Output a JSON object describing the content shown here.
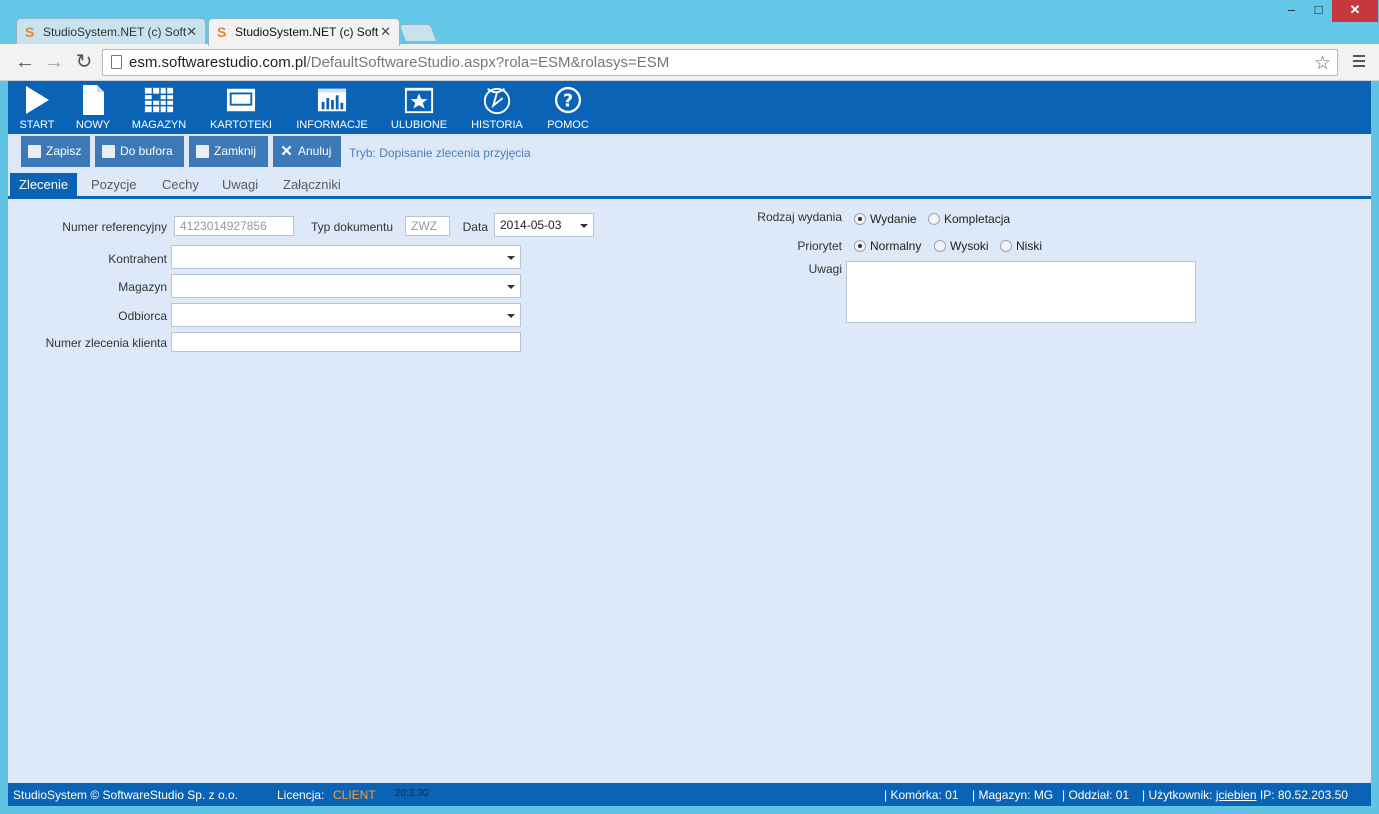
{
  "browser": {
    "tabs": [
      {
        "title": "StudioSystem.NET (c) Soft",
        "active": false
      },
      {
        "title": "StudioSystem.NET (c) Soft",
        "active": true
      }
    ],
    "url_host": "esm.softwarestudio.com.pl",
    "url_path": "/DefaultSoftwareStudio.aspx?rola=ESM&rolasys=ESM",
    "window_controls": {
      "minimize": "–",
      "maximize": "□",
      "close": "✕"
    }
  },
  "mainnav": [
    {
      "label": "START",
      "icon": "play-icon"
    },
    {
      "label": "NOWY",
      "icon": "new-document-icon"
    },
    {
      "label": "MAGAZYN",
      "icon": "warehouse-grid-icon"
    },
    {
      "label": "KARTOTEKI",
      "icon": "card-index-icon"
    },
    {
      "label": "INFORMACJE",
      "icon": "bar-chart-icon"
    },
    {
      "label": "ULUBIONE",
      "icon": "star-icon"
    },
    {
      "label": "HISTORIA",
      "icon": "history-icon"
    },
    {
      "label": "POMOC",
      "icon": "help-icon"
    }
  ],
  "toolbar": {
    "save": "Zapisz",
    "to_buffer": "Do bufora",
    "close": "Zamknij",
    "cancel": "Anuluj",
    "mode": "Tryb: Dopisanie zlecenia przyjęcia"
  },
  "form_tabs": [
    "Zlecenie",
    "Pozycje",
    "Cechy",
    "Uwagi",
    "Załączniki"
  ],
  "form": {
    "ref_number_label": "Numer referencyjny",
    "ref_number_value": "4123014927856",
    "doc_type_label": "Typ dokumentu",
    "doc_type_value": "ZWZ",
    "date_label": "Data",
    "date_value": "2014-05-03",
    "contractor_label": "Kontrahent",
    "contractor_value": "",
    "warehouse_label": "Magazyn",
    "warehouse_value": "",
    "recipient_label": "Odbiorca",
    "recipient_value": "",
    "client_order_label": "Numer zlecenia klienta",
    "client_order_value": "",
    "release_type_label": "Rodzaj wydania",
    "release_type_options": [
      "Wydanie",
      "Kompletacja"
    ],
    "release_type_selected": "Wydanie",
    "priority_label": "Priorytet",
    "priority_options": [
      "Normalny",
      "Wysoki",
      "Niski"
    ],
    "priority_selected": "Normalny",
    "notes_label": "Uwagi",
    "notes_value": ""
  },
  "status": {
    "copyright": "StudioSystem © SoftwareStudio Sp. z o.o.",
    "license_label": "Licencja:",
    "license_value": "CLIENT",
    "time": "20:3.30",
    "cell": "Komórka: 01",
    "warehouse": "Magazyn: MG",
    "branch": "Oddział: 01",
    "user_label": "Użytkownik:",
    "user": "jciebien",
    "ip": "IP: 80.52.203.50"
  }
}
